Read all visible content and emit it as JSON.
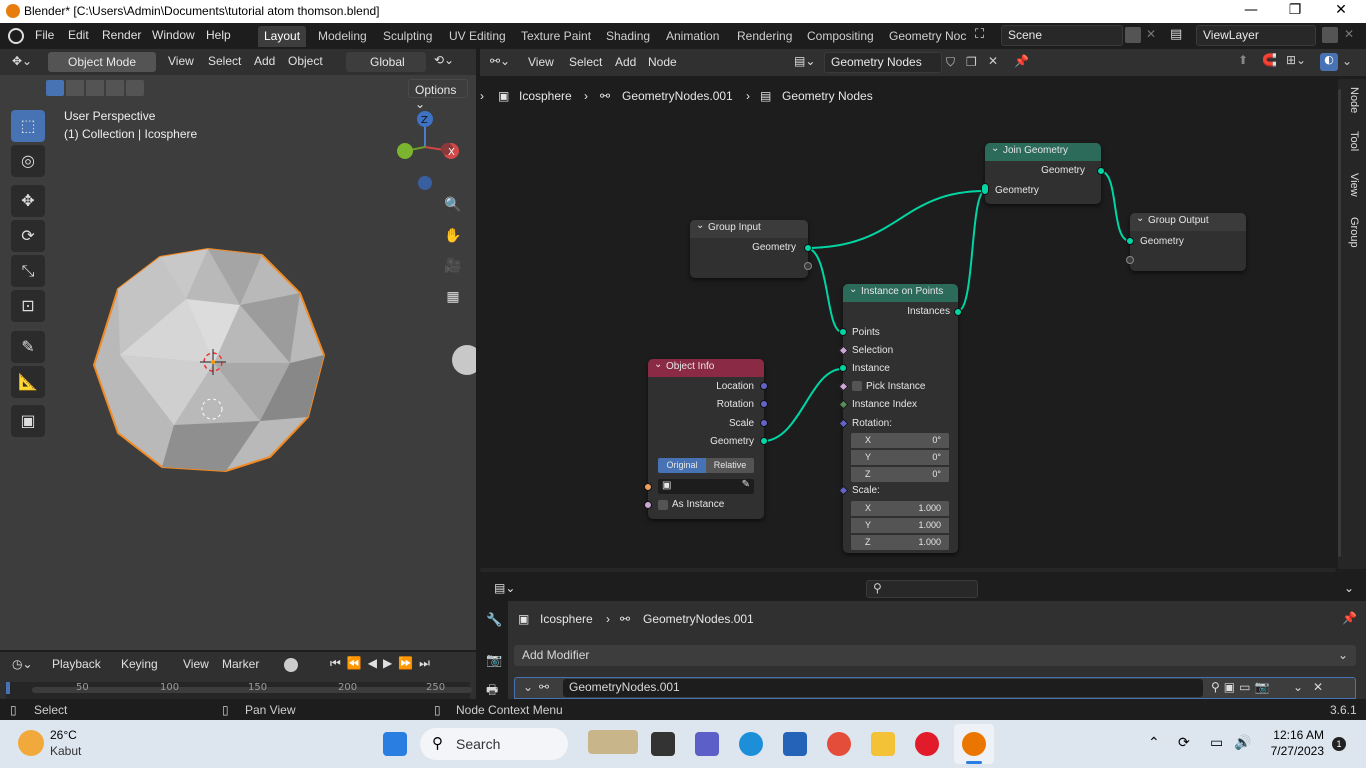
{
  "window": {
    "title": "Blender* [C:\\Users\\Admin\\Documents\\tutorial atom thomson.blend]",
    "min": "—",
    "max": "❐",
    "close": "✕"
  },
  "menu": [
    "File",
    "Edit",
    "Render",
    "Window",
    "Help"
  ],
  "workspaces": [
    "Layout",
    "Modeling",
    "Sculpting",
    "UV Editing",
    "Texture Paint",
    "Shading",
    "Animation",
    "Rendering",
    "Compositing",
    "Geometry Noc"
  ],
  "scene": "Scene",
  "view_layer": "ViewLayer",
  "viewport": {
    "mode": "Object Mode",
    "menus": [
      "View",
      "Select",
      "Add",
      "Object"
    ],
    "transform": "Global",
    "options": "Options",
    "perspective": "User Perspective",
    "collection": "(1) Collection | Icosphere",
    "gizmo_z": "Z",
    "gizmo_x": "X"
  },
  "timeline": {
    "menus": [
      "Playback",
      "Keying",
      "View",
      "Marker"
    ],
    "ticks": [
      "50",
      "100",
      "150",
      "200",
      "250"
    ]
  },
  "node_editor": {
    "menus": [
      "View",
      "Select",
      "Add",
      "Node"
    ],
    "tree_name": "Geometry Nodes",
    "breadcrumb": [
      "Icosphere",
      "GeometryNodes.001",
      "Geometry Nodes"
    ],
    "side_tabs": [
      "Node",
      "Tool",
      "View",
      "Group"
    ],
    "nodes": {
      "group_input": {
        "title": "Group Input",
        "out": "Geometry"
      },
      "join_geometry": {
        "title": "Join Geometry",
        "out": "Geometry",
        "in": "Geometry"
      },
      "group_output": {
        "title": "Group Output",
        "in": "Geometry"
      },
      "instance_on_points": {
        "title": "Instance on Points",
        "out": "Instances",
        "inputs": [
          "Points",
          "Selection",
          "Instance",
          "Pick Instance",
          "Instance Index",
          "Rotation:"
        ],
        "rotation": [
          {
            "axis": "X",
            "value": "0°"
          },
          {
            "axis": "Y",
            "value": "0°"
          },
          {
            "axis": "Z",
            "value": "0°"
          }
        ],
        "scale_label": "Scale:",
        "scale": [
          {
            "axis": "X",
            "value": "1.000"
          },
          {
            "axis": "Y",
            "value": "1.000"
          },
          {
            "axis": "Z",
            "value": "1.000"
          }
        ]
      },
      "object_info": {
        "title": "Object Info",
        "outputs": [
          "Location",
          "Rotation",
          "Scale",
          "Geometry"
        ],
        "mode_original": "Original",
        "mode_relative": "Relative",
        "as_instance": "As Instance"
      }
    }
  },
  "properties": {
    "breadcrumb": [
      "Icosphere",
      "GeometryNodes.001"
    ],
    "add_modifier": "Add Modifier",
    "modifier_name": "GeometryNodes.001"
  },
  "status": {
    "select": "Select",
    "pan": "Pan View",
    "context": "Node Context Menu",
    "version": "3.6.1"
  },
  "taskbar": {
    "weather_temp": "26°C",
    "weather_desc": "Kabut",
    "search": "Search",
    "time": "12:16 AM",
    "date": "7/27/2023",
    "notif": "1"
  }
}
